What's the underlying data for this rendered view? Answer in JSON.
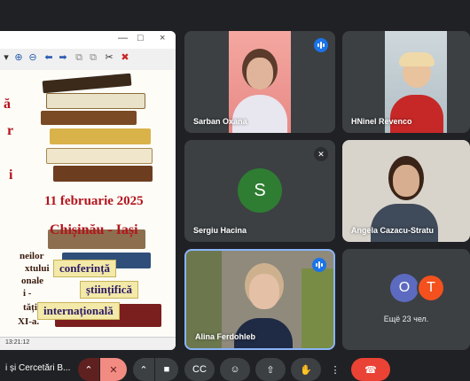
{
  "shared_screen": {
    "window_controls": [
      "×",
      "□",
      "—"
    ],
    "status_time": "13:21:12",
    "slide": {
      "date": "11 februarie 2025",
      "place": "Chișinău - Iași",
      "banner1": "conferință",
      "banner2": "științifică",
      "banner3": "internațională",
      "left_fragments": [
        "ă",
        "r",
        "i",
        "neilor",
        "xtului",
        "onale",
        "i -",
        "tății",
        "XI-a."
      ]
    }
  },
  "participants": [
    {
      "name": "Sarban Oxana",
      "state": "speaking"
    },
    {
      "name": "HNinel Revenco",
      "state": "video"
    },
    {
      "name": "Sergiu Hacina",
      "initial": "S",
      "avatar_color": "#2e7d32",
      "state": "muted"
    },
    {
      "name": "Angela Cazacu-Stratu",
      "state": "video"
    },
    {
      "name": "Alina Ferdohleb",
      "state": "speaking"
    }
  ],
  "others": {
    "avatars": [
      {
        "initial": "O",
        "color": "#5c6bc0"
      },
      {
        "initial": "T",
        "color": "#f4511e"
      }
    ],
    "label": "Ещё 23 чел."
  },
  "meeting": {
    "title": "i și Cercetări B..."
  },
  "controls": {
    "icons": [
      "chevron-up-icon",
      "mic-off-icon",
      "camera-icon",
      "captions-icon",
      "emoji-icon",
      "present-icon",
      "hand-icon",
      "more-icon",
      "end-call-icon"
    ],
    "accent": "#1a73e8",
    "danger": "#ea4335",
    "mic_off_bg": "#f28b82"
  }
}
